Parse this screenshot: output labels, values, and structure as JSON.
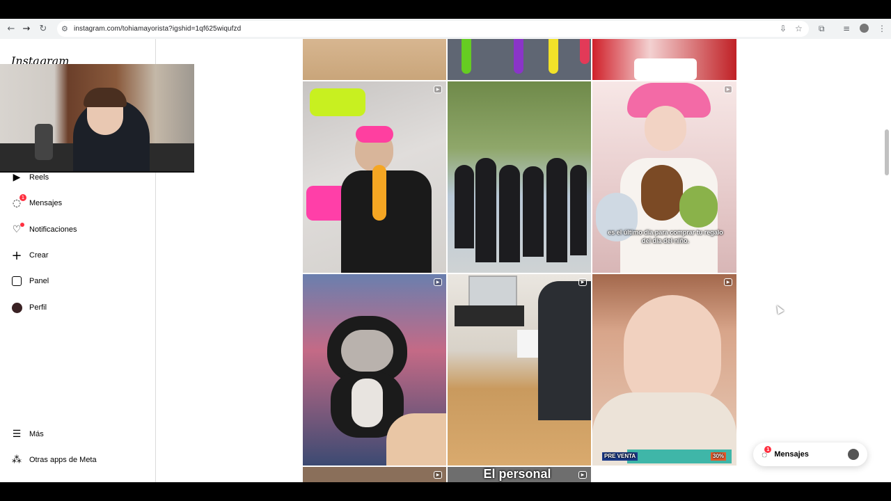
{
  "browser": {
    "url": "instagram.com/tohiamayorista?igshid=1qf625wiqufzd",
    "icons": [
      "back-icon",
      "forward-icon",
      "reload-icon",
      "site-info-icon",
      "install-icon",
      "bookmark-star-icon",
      "extensions-icon",
      "media-icon",
      "profile-icon",
      "menu-icon"
    ]
  },
  "sidebar": {
    "logo": "Instagram",
    "items": [
      {
        "label": "Reels",
        "icon": "reels-icon"
      },
      {
        "label": "Mensajes",
        "icon": "messenger-icon",
        "badge": "1"
      },
      {
        "label": "Notificaciones",
        "icon": "heart-icon",
        "dot": true
      },
      {
        "label": "Crear",
        "icon": "plus-icon"
      },
      {
        "label": "Panel",
        "icon": "chart-icon"
      },
      {
        "label": "Perfil",
        "icon": "avatar-icon"
      }
    ],
    "bottom": [
      {
        "label": "Más",
        "icon": "hamburger-icon"
      },
      {
        "label": "Otras apps de Meta",
        "icon": "apps-icon"
      }
    ]
  },
  "posts": {
    "overlay1": "es el último día para comprar tu regalo del día del niño.",
    "overlay2": "El personal",
    "caption_small": "PRE VENTA",
    "promo": "30%"
  },
  "messages_pill": {
    "label": "Mensajes",
    "badge": "1"
  },
  "colors": {
    "accent": "#ff3040",
    "border": "#dbdbdb"
  }
}
